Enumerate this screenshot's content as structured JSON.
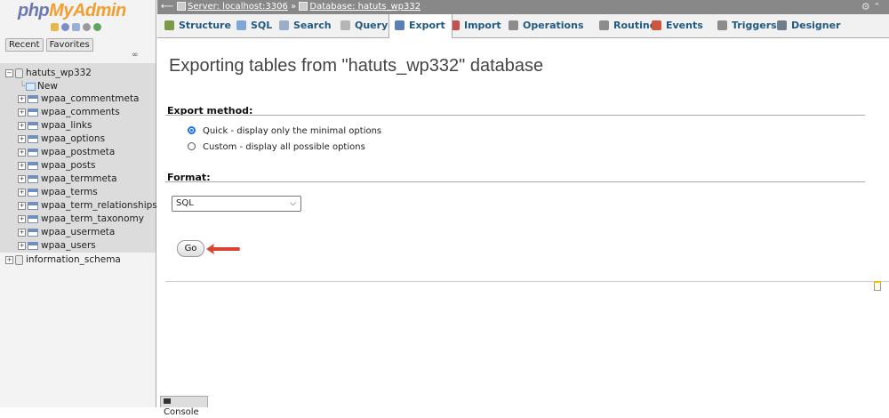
{
  "nav": {
    "logo_php": "php",
    "logo_rest": "MyAdmin",
    "icons": [
      "home-icon",
      "logout-icon",
      "docs-icon",
      "settings-icon",
      "reload-icon"
    ],
    "tabs": [
      {
        "label": "Recent"
      },
      {
        "label": "Favorites"
      }
    ],
    "link_icon": "link-icon",
    "tree": [
      {
        "label": "hatuts_wp332",
        "kind": "db",
        "expanded": true
      },
      {
        "label": "New",
        "kind": "new"
      },
      {
        "label": "wpaa_commentmeta",
        "kind": "table"
      },
      {
        "label": "wpaa_comments",
        "kind": "table"
      },
      {
        "label": "wpaa_links",
        "kind": "table"
      },
      {
        "label": "wpaa_options",
        "kind": "table"
      },
      {
        "label": "wpaa_postmeta",
        "kind": "table"
      },
      {
        "label": "wpaa_posts",
        "kind": "table"
      },
      {
        "label": "wpaa_termmeta",
        "kind": "table"
      },
      {
        "label": "wpaa_terms",
        "kind": "table"
      },
      {
        "label": "wpaa_term_relationships",
        "kind": "table"
      },
      {
        "label": "wpaa_term_taxonomy",
        "kind": "table"
      },
      {
        "label": "wpaa_usermeta",
        "kind": "table"
      },
      {
        "label": "wpaa_users",
        "kind": "table"
      },
      {
        "label": "information_schema",
        "kind": "db",
        "expanded": false
      }
    ]
  },
  "topbar": {
    "server": "Server: localhost:3306",
    "separator": "»",
    "database": "Database: hatuts_wp332"
  },
  "menu": {
    "tabs": [
      {
        "label": "Structure",
        "icon": "structure-icon",
        "color": "#7a9a4a"
      },
      {
        "label": "SQL",
        "icon": "sql-icon",
        "color": "#7fa7d6"
      },
      {
        "label": "Search",
        "icon": "search-icon",
        "color": "#9aaecb"
      },
      {
        "label": "Query",
        "icon": "query-icon",
        "color": "#b5b5b5"
      },
      {
        "label": "Export",
        "icon": "export-icon",
        "color": "#5a7fb5",
        "active": true
      },
      {
        "label": "Import",
        "icon": "import-icon",
        "color": "#c45050"
      },
      {
        "label": "Operations",
        "icon": "operations-icon",
        "color": "#8c8c8c"
      },
      {
        "label": "Routines",
        "icon": "routines-icon",
        "color": "#8c8c8c"
      },
      {
        "label": "Events",
        "icon": "events-icon",
        "color": "#d0553d"
      },
      {
        "label": "Triggers",
        "icon": "triggers-icon",
        "color": "#8c8c8c"
      },
      {
        "label": "Designer",
        "icon": "designer-icon",
        "color": "#6d7d8d"
      }
    ]
  },
  "main": {
    "title": "Exporting tables from \"hatuts_wp332\" database",
    "export_method": {
      "heading": "Export method:",
      "options": [
        {
          "label": "Quick - display only the minimal options",
          "selected": true
        },
        {
          "label": "Custom - display all possible options",
          "selected": false
        }
      ]
    },
    "format": {
      "heading": "Format:",
      "selected": "SQL"
    },
    "go_label": "Go"
  },
  "console": {
    "label": "Console"
  },
  "colors": {
    "accent": "#235a81",
    "logo_blue": "#6c78af",
    "logo_orange": "#f29e30",
    "arrow": "#d9432f"
  }
}
